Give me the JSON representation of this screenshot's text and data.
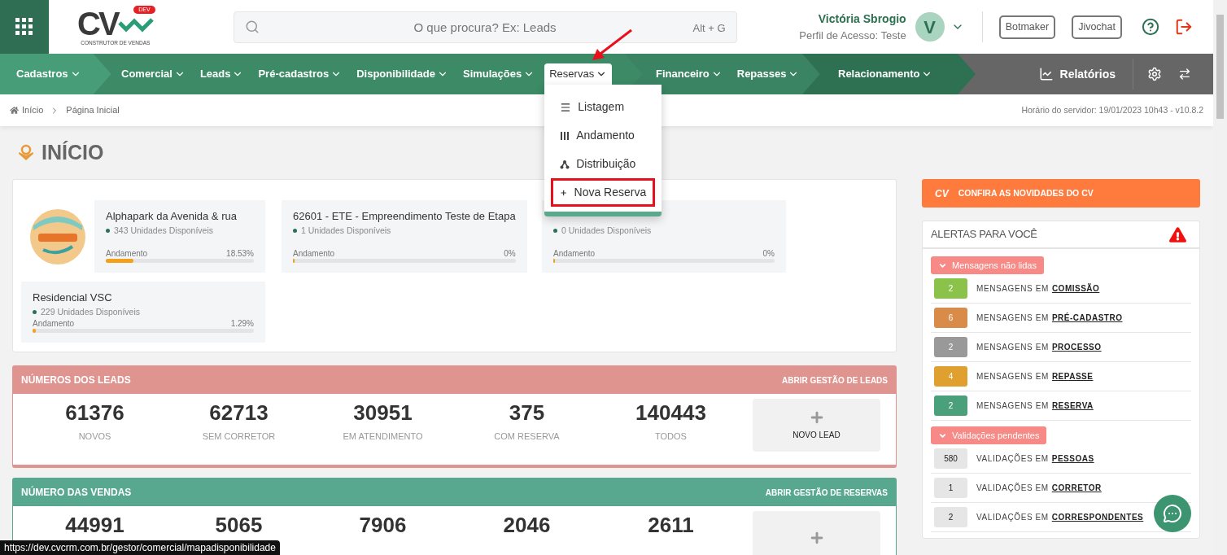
{
  "logo": {
    "text": "CV",
    "badge": "DEV",
    "tagline": "CONSTRUTOR DE VENDAS"
  },
  "search": {
    "placeholder": "O que procura? Ex: Leads",
    "shortcut": "Alt + G"
  },
  "user": {
    "name": "Victória Sbrogio",
    "profile": "Perfil de Acesso: Teste",
    "initial": "V"
  },
  "header_buttons": [
    "Botmaker",
    "Jivochat"
  ],
  "nav": {
    "sections": [
      {
        "items": [
          {
            "label": "Cadastros",
            "selected": false
          }
        ]
      },
      {
        "items": [
          {
            "label": "Comercial",
            "selected": false
          },
          {
            "label": "Leads",
            "selected": false
          },
          {
            "label": "Pré-cadastros",
            "selected": false
          },
          {
            "label": "Disponibilidade",
            "selected": false
          },
          {
            "label": "Simulações",
            "selected": false
          },
          {
            "label": "Reservas",
            "selected": true
          }
        ]
      },
      {
        "items": [
          {
            "label": "Financeiro",
            "selected": false
          },
          {
            "label": "Repasses",
            "selected": false
          }
        ]
      },
      {
        "items": [
          {
            "label": "Relacionamento",
            "selected": false
          }
        ]
      }
    ],
    "reports": "Relatórios"
  },
  "dropdown": {
    "items": [
      {
        "label": "Listagem",
        "kind": "list",
        "highlighted": false
      },
      {
        "label": "Andamento",
        "kind": "bars",
        "highlighted": false
      },
      {
        "label": "Distribuição",
        "kind": "tree",
        "highlighted": false
      },
      {
        "label": "Nova Reserva",
        "kind": "plus",
        "highlighted": true
      }
    ]
  },
  "breadcrumb": {
    "items": [
      "Início",
      "Página Inicial"
    ],
    "server_time": "Horário do servidor: 19/01/2023 10h43 - v10.8.2"
  },
  "page_title": "INÍCIO",
  "developments": [
    {
      "title": "Alphapark da Avenida & rua",
      "logo": true,
      "units": "343 Unidades Disponíveis",
      "progress_label": "Andamento",
      "reading": "18.53%",
      "level": 0.1853
    },
    {
      "title": "62601 - ETE - Empreendimento Teste de Etapa",
      "logo": false,
      "units": "1 Unidades Disponíveis",
      "progress_label": "Andamento",
      "reading": "0%",
      "level": 0
    },
    {
      "logo": false,
      "units": "0 Unidades Disponíveis",
      "progress_label": "Andamento",
      "reading": "0%",
      "level": 0
    },
    {
      "title": "Residencial VSC",
      "logo": false,
      "units": "229 Unidades Disponíveis",
      "progress_label": "Andamento",
      "reading": "1.29%",
      "level": 0.0129
    }
  ],
  "leads_panel": {
    "title": "NÚMEROS DOS LEADS",
    "link": "ABRIR GESTÃO DE LEADS",
    "stats": [
      {
        "value": "61376",
        "label": "NOVOS"
      },
      {
        "value": "62713",
        "label": "SEM CORRETOR"
      },
      {
        "value": "30951",
        "label": "EM ATENDIMENTO"
      },
      {
        "value": "375",
        "label": "COM RESERVA"
      },
      {
        "value": "140443",
        "label": "TODOS"
      }
    ],
    "action": "NOVO LEAD"
  },
  "sales_panel": {
    "title": "NÚMERO DAS VENDAS",
    "link": "ABRIR GESTÃO DE RESERVAS",
    "stats": [
      {
        "value": "44991"
      },
      {
        "value": "5065"
      },
      {
        "value": "7906"
      },
      {
        "value": "2046"
      },
      {
        "value": "2611"
      }
    ]
  },
  "news_banner": {
    "logo": "CV",
    "text": "CONFIRA AS NOVIDADES DO CV"
  },
  "alerts": {
    "title": "ALERTAS PARA VOCÊ",
    "groups": [
      {
        "title": "Mensagens não lidas",
        "expanded": true,
        "rows": [
          {
            "count": "2",
            "color": "#8bc34a",
            "text": "MENSAGENS EM",
            "link": "COMISSÃO"
          },
          {
            "count": "6",
            "color": "#d98c4a",
            "text": "MENSAGENS EM",
            "link": "PRÉ-CADASTRO"
          },
          {
            "count": "2",
            "color": "#999999",
            "text": "MENSAGENS EM",
            "link": "PROCESSO"
          },
          {
            "count": "4",
            "color": "#e0a030",
            "text": "MENSAGENS EM",
            "link": "REPASSE"
          },
          {
            "count": "2",
            "color": "#4aa07a",
            "text": "MENSAGENS EM",
            "link": "RESERVA"
          }
        ]
      },
      {
        "title": "Validações pendentes",
        "expanded": true,
        "rows": [
          {
            "count": "580",
            "color": "#e6e6e6",
            "text": "VALIDAÇÕES EM",
            "link": "PESSOAS"
          },
          {
            "count": "1",
            "color": "#e6e6e6",
            "text": "VALIDAÇÕES EM",
            "link": "CORRETOR"
          },
          {
            "count": "2",
            "color": "#e6e6e6",
            "text": "VALIDAÇÕES EM",
            "link": "CORRESPONDENTES"
          }
        ]
      }
    ]
  },
  "status_url": "https://dev.cvcrm.com.br/gestor/comercial/mapadisponibilidade"
}
